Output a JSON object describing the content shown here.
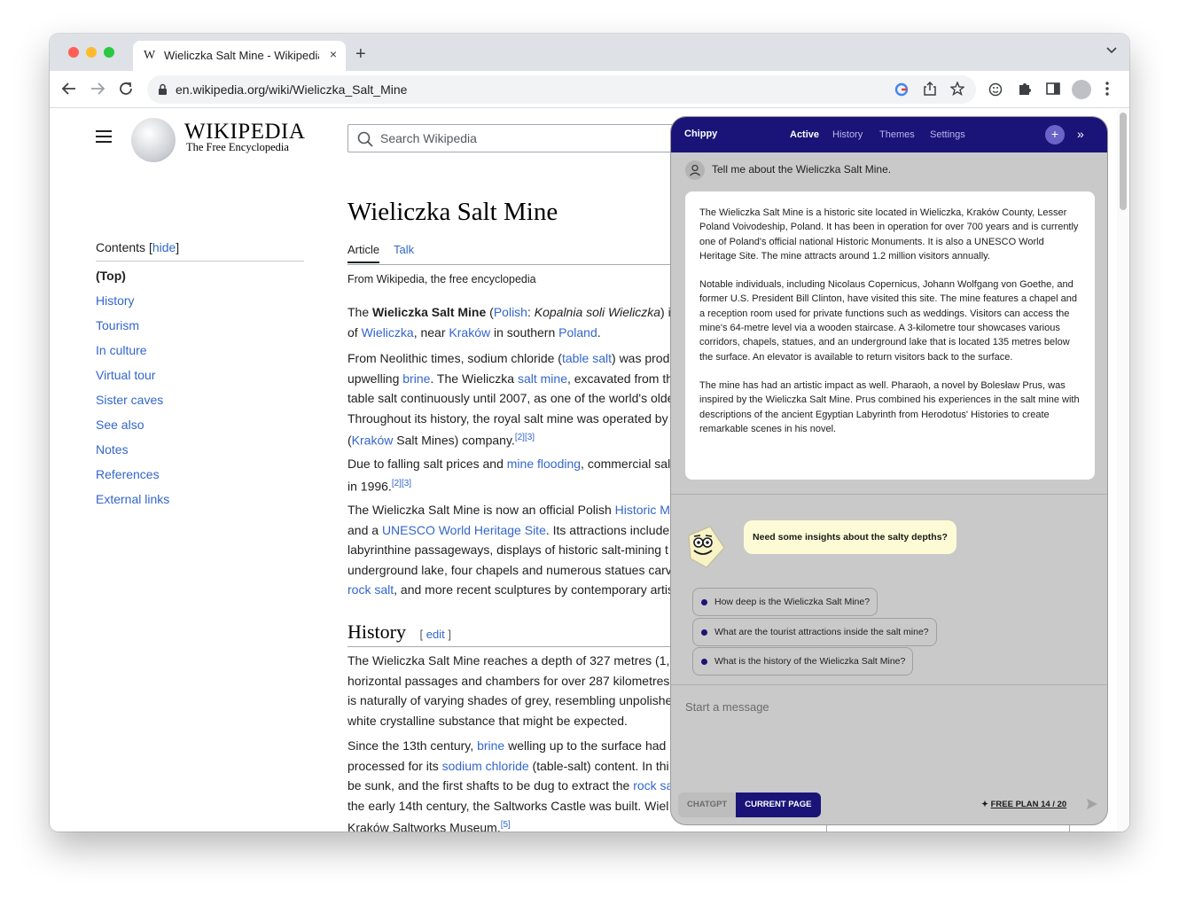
{
  "browser": {
    "tab_title": "Wieliczka Salt Mine - Wikipedia",
    "tab_favicon": "W",
    "url": "en.wikipedia.org/wiki/Wieliczka_Salt_Mine",
    "new_tab": "+",
    "tab_close": "×"
  },
  "wiki": {
    "logo_title": "WIKIPEDIA",
    "logo_tagline": "The Free Encyclopedia",
    "search_placeholder": "Search Wikipedia",
    "toc_label": "Contents",
    "toc_hide": "hide",
    "toc_items": [
      "(Top)",
      "History",
      "Tourism",
      "In culture",
      "Virtual tour",
      "Sister caves",
      "See also",
      "Notes",
      "References",
      "External links"
    ],
    "title": "Wieliczka Salt Mine",
    "tabs": [
      "Article",
      "Talk"
    ],
    "from_line": "From Wikipedia, the free encyclopedia",
    "history_heading": "History",
    "edit_label": "edit",
    "p1_l1_a": "The ",
    "p1_l1_b": "Wieliczka Salt Mine",
    "p1_l1_c": " (",
    "p1_l1_d": "Polish",
    "p1_l1_e": ": ",
    "p1_l1_f": "Kopalnia soli Wieliczka",
    "p1_l1_g": ") i",
    "p1_l2_a": "of ",
    "p1_l2_b": "Wieliczka",
    "p1_l2_c": ", near ",
    "p1_l2_d": "Kraków",
    "p1_l2_e": " in southern ",
    "p1_l2_f": "Poland",
    "p1_l2_g": ".",
    "p2_l1_a": "From Neolithic times, sodium chloride (",
    "p2_l1_b": "table salt",
    "p2_l1_c": ") was prod",
    "p2_l2_a": "upwelling ",
    "p2_l2_b": "brine",
    "p2_l2_c": ". The Wieliczka ",
    "p2_l2_d": "salt mine",
    "p2_l2_e": ", excavated from th",
    "p2_l3": "table salt continuously until 2007, as one of the world's olde",
    "p2_l4": "Throughout its history, the royal salt mine was operated by",
    "p2_l5_a": "(",
    "p2_l5_b": "Kraków",
    "p2_l5_c": " Salt Mines) company.",
    "p2_l5_ref": "[2][3]",
    "p3_l1_a": "Due to falling salt prices and ",
    "p3_l1_b": "mine flooding",
    "p3_l1_c": ", commercial sal",
    "p3_l2_a": "in 1996.",
    "p3_l2_ref": "[2][3]",
    "p4_l1_a": "The Wieliczka Salt Mine is now an official Polish ",
    "p4_l1_b": "Historic M",
    "p4_l2_a": "and a ",
    "p4_l2_b": "UNESCO World Heritage Site",
    "p4_l2_c": ". Its attractions include",
    "p4_l3": "labyrinthine passageways, displays of historic salt-mining t",
    "p4_l4": "underground lake, four chapels and numerous statues carv",
    "p4_l5_a": "rock salt",
    "p4_l5_b": ", and more recent sculptures by contemporary artis",
    "h_l1": "The Wieliczka Salt Mine reaches a depth of 327 metres (1,",
    "h_l2": "horizontal passages and chambers for over 287 kilometres",
    "h_l3": "is naturally of varying shades of grey, resembling unpolishe",
    "h_l4": "white crystalline substance that might be expected.",
    "h2_l1_a": "Since the 13th century, ",
    "h2_l1_b": "brine",
    "h2_l1_c": " welling up to the surface had",
    "h2_l2_a": "processed for its ",
    "h2_l2_b": "sodium chloride",
    "h2_l2_c": " (table-salt) content. In thi",
    "h2_l3_a": "be sunk, and the first shafts to be dug to extract the ",
    "h2_l3_b": "rock sa",
    "h2_l4": "the early 14th century, the Saltworks Castle was built. Wiel",
    "h2_l5_a": "Kraków Saltworks Museum.",
    "h2_l5_ref": "[5]"
  },
  "chippy": {
    "brand": "Chippy",
    "tabs": [
      "Active",
      "History",
      "Themes",
      "Settings"
    ],
    "plus": "+",
    "collapse": "»",
    "user_message": "Tell me about the Wieliczka Salt Mine.",
    "answer": [
      "The Wieliczka Salt Mine is a historic site located in Wieliczka, Kraków County, Lesser Poland Voivodeship, Poland. It has been in operation for over 700 years and is currently one of Poland's official national Historic Monuments. It is also a UNESCO World Heritage Site. The mine attracts around 1.2 million visitors annually.",
      "Notable individuals, including Nicolaus Copernicus, Johann Wolfgang von Goethe, and former U.S. President Bill Clinton, have visited this site. The mine features a chapel and a reception room used for private functions such as weddings. Visitors can access the mine's 64-metre level via a wooden staircase. A 3-kilometre tour showcases various corridors, chapels, statues, and an underground lake that is located 135 metres below the surface. An elevator is available to return visitors back to the surface.",
      "The mine has had an artistic impact as well. Pharaoh, a novel by Bolesław Prus, was inspired by the Wieliczka Salt Mine. Prus combined his experiences in the salt mine with descriptions of the ancient Egyptian Labyrinth from Herodotus' Histories to create remarkable scenes in his novel."
    ],
    "prompt_bubble": "Need some insights about the salty depths?",
    "suggestions": [
      "How deep is the Wieliczka Salt Mine?",
      "What are the tourist attractions inside the salt mine?",
      "What is the history of the Wieliczka Salt Mine?"
    ],
    "input_placeholder": "Start a message",
    "mode_chatgpt": "CHATGPT",
    "mode_page": "CURRENT PAGE",
    "plan_label": "FREE PLAN 14 / 20",
    "accent_color": "#1a1478"
  }
}
